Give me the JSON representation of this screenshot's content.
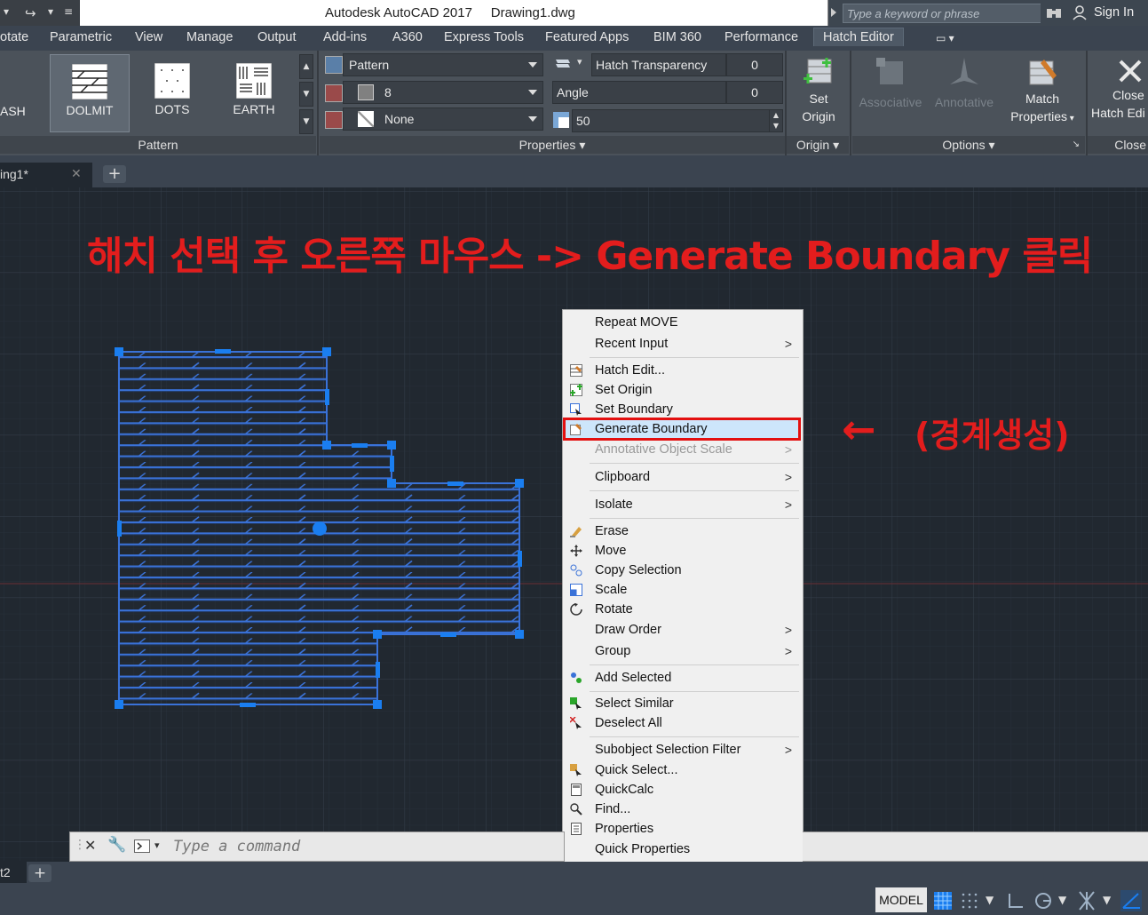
{
  "titlebar": {
    "app_title": "Autodesk AutoCAD 2017",
    "drawing_name": "Drawing1.dwg",
    "search_placeholder": "Type a keyword or phrase",
    "sign_in": "Sign In"
  },
  "ribbon_tabs": [
    "otate",
    "Parametric",
    "View",
    "Manage",
    "Output",
    "Add-ins",
    "A360",
    "Express Tools",
    "Featured Apps",
    "BIM 360",
    "Performance",
    "Hatch Editor"
  ],
  "pattern_panel": {
    "buttons": [
      "ASH",
      "DOLMIT",
      "DOTS",
      "EARTH"
    ],
    "selected": "DOLMIT",
    "footer": "Pattern"
  },
  "properties_panel": {
    "pattern_type": "Pattern",
    "color_value": "8",
    "background": "None",
    "transparency_label": "Hatch Transparency",
    "transparency_value": "0",
    "angle_label": "Angle",
    "angle_value": "0",
    "scale_value": "50",
    "footer": "Properties"
  },
  "origin_panel": {
    "set_origin_line1": "Set",
    "set_origin_line2": "Origin",
    "footer": "Origin"
  },
  "options_panel": {
    "associative": "Associative",
    "annotative": "Annotative",
    "match_line1": "Match",
    "match_line2": "Properties",
    "footer": "Options"
  },
  "close_panel": {
    "line1": "Close",
    "line2": "Hatch Edi",
    "footer": "Close"
  },
  "file_tab": {
    "label": "ing1*"
  },
  "annotation": {
    "instruction": "해치 선택 후 오른쪽 마우스 -> Generate Boundary 클릭",
    "arrow": "←",
    "korean_label": "(경계생성)",
    "color": "#e31d1d"
  },
  "context_menu": {
    "repeat_move": "Repeat MOVE",
    "recent_input": "Recent Input",
    "hatch_edit": "Hatch Edit...",
    "set_origin": "Set Origin",
    "set_boundary": "Set Boundary",
    "generate_boundary": "Generate Boundary",
    "annotative_scale": "Annotative Object Scale",
    "clipboard": "Clipboard",
    "isolate": "Isolate",
    "erase": "Erase",
    "move": "Move",
    "copy_selection": "Copy Selection",
    "scale": "Scale",
    "rotate": "Rotate",
    "draw_order": "Draw Order",
    "group": "Group",
    "add_selected": "Add Selected",
    "select_similar": "Select Similar",
    "deselect_all": "Deselect All",
    "subobject_filter": "Subobject Selection Filter",
    "quick_select": "Quick Select...",
    "quickcalc": "QuickCalc",
    "find": "Find...",
    "properties": "Properties",
    "quick_properties": "Quick Properties",
    "submenu_arrow": ">"
  },
  "command_line": {
    "placeholder": "Type a command"
  },
  "layout_tab": {
    "label": "t2"
  },
  "status_bar": {
    "model": "MODEL"
  },
  "colors": {
    "hatch": "#3a72d8",
    "grip": "#1a7ef0",
    "highlight": "#cde6fb"
  }
}
